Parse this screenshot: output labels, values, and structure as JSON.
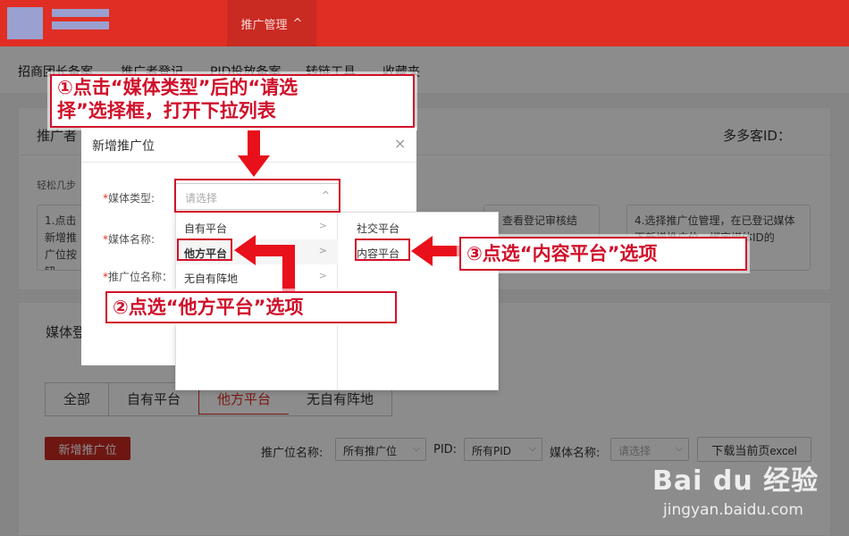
{
  "header": {
    "nav_label": "推广管理",
    "nav_chevron": "^"
  },
  "subnav": {
    "items": [
      "招商团长备案",
      "推广者登记",
      "PID投放备案",
      "转链工具",
      "收藏夹"
    ]
  },
  "background": {
    "panel1_title": "推广者",
    "partner_id_label": "多多客ID：",
    "steps_intro": "轻松几步",
    "step1_text": "1.点击新增推广位按钮",
    "step3_text": "，查看登记审核结",
    "step4_text": "4.选择推广位管理，在已登记媒体下新增推广位，绑定媒体ID的",
    "panel2_title": "媒体登",
    "tabs": [
      "全部",
      "自有平台",
      "他方平台",
      "无自有阵地"
    ],
    "active_tab": "他方平台",
    "add_button": "新增推广位",
    "filters": {
      "slot_name_label": "推广位名称:",
      "slot_name_value": "所有推广位",
      "pid_label": "PID:",
      "pid_value": "所有PID",
      "media_name_label": "媒体名称:",
      "media_name_placeholder": "请选择"
    },
    "export_button": "下载当前页excel"
  },
  "modal": {
    "title": "新增推广位",
    "close": "×",
    "fields": {
      "media_type_label": "媒体类型:",
      "media_name_label": "媒体名称:",
      "slot_name_label": "推广位名称："
    },
    "required_mark": "*",
    "media_type_placeholder": "请选择"
  },
  "cascader": {
    "level1": [
      "自有平台",
      "他方平台",
      "无自有阵地"
    ],
    "level1_active": "他方平台",
    "level2": [
      "社交平台",
      "内容平台"
    ],
    "level2_highlighted": "内容平台"
  },
  "annotations": {
    "step1_line1": "①点击“媒体类型”后的“请选",
    "step1_line2": "择”选择框，打开下拉列表",
    "step2": "②点选“他方平台”选项",
    "step3": "③点选“内容平台”选项"
  },
  "watermark": {
    "main": "Bai du 经验",
    "sub": "jingyan.baidu.com"
  },
  "colors": {
    "brand": "#e02e24",
    "annotation": "#d0102a"
  }
}
